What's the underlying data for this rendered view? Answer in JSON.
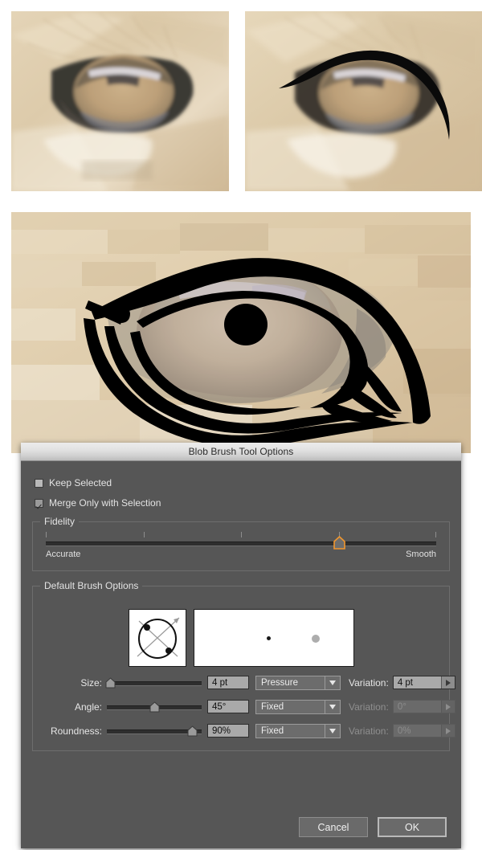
{
  "dialog": {
    "title": "Blob Brush Tool Options",
    "checkboxes": [
      {
        "label": "Keep Selected",
        "checked": false
      },
      {
        "label": "Merge Only with Selection",
        "checked": true
      }
    ],
    "fidelity": {
      "legend": "Fidelity",
      "min_label": "Accurate",
      "max_label": "Smooth",
      "value_percent": 75,
      "handle_color": "#f0962e"
    },
    "brush": {
      "legend": "Default Brush Options",
      "rows": [
        {
          "label": "Size:",
          "slider_percent": 3,
          "value": "4 pt",
          "mode": "Pressure",
          "mode_disabled": false,
          "variation_label": "Variation:",
          "variation_value": "4 pt",
          "variation_disabled": false
        },
        {
          "label": "Angle:",
          "slider_percent": 50,
          "value": "45°",
          "mode": "Fixed",
          "mode_disabled": false,
          "variation_label": "Variation:",
          "variation_value": "0°",
          "variation_disabled": true
        },
        {
          "label": "Roundness:",
          "slider_percent": 90,
          "value": "90%",
          "mode": "Fixed",
          "mode_disabled": false,
          "variation_label": "Variation:",
          "variation_value": "0%",
          "variation_disabled": true
        }
      ]
    },
    "buttons": {
      "cancel": "Cancel",
      "ok": "OK"
    },
    "colors": {
      "body_bg": "#565656",
      "title_bg": "#e2e2e2",
      "accent": "#f0962e"
    }
  },
  "canvas": {
    "panels": [
      {
        "name": "original-eye-photo",
        "caption": ""
      },
      {
        "name": "eye-photo-with-single-stroke",
        "caption": ""
      },
      {
        "name": "zoomed-eye-photo-with-vector-drawing",
        "caption": ""
      }
    ]
  }
}
